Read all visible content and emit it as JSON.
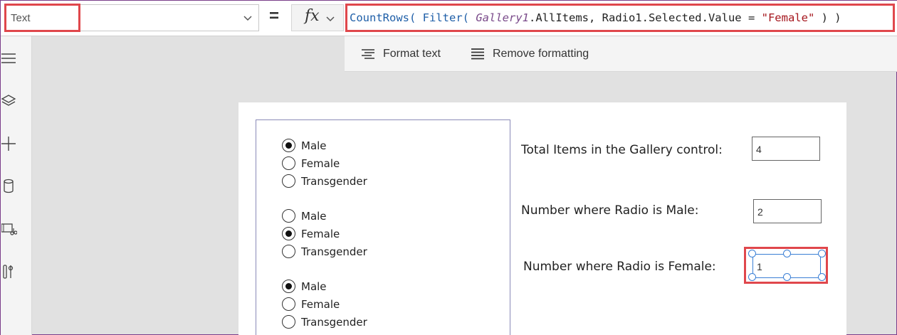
{
  "formula_bar": {
    "property": "Text",
    "equals": "=",
    "fx_label": "fx",
    "formula": {
      "part1": "CountRows(",
      "part2": " ",
      "part3": "Filter(",
      "part4": " ",
      "part5": "Gallery1",
      "part6": ".AllItems, Radio1.Selected.Value = ",
      "part7": "\"Female\"",
      "part8": " ) )"
    }
  },
  "format_toolbar": {
    "format_text": "Format text",
    "remove_formatting": "Remove formatting"
  },
  "left_rail": {
    "icons": [
      "hamburger-menu-icon",
      "layers-icon",
      "plus-icon",
      "database-icon",
      "media-icon",
      "tools-icon"
    ]
  },
  "gallery": {
    "items": [
      {
        "options": [
          "Male",
          "Female",
          "Transgender"
        ],
        "selected": 0
      },
      {
        "options": [
          "Male",
          "Female",
          "Transgender"
        ],
        "selected": 1
      },
      {
        "options": [
          "Male",
          "Female",
          "Transgender"
        ],
        "selected": 0
      }
    ]
  },
  "labels": {
    "total_items": "Total Items in the Gallery control:",
    "male_count": "Number where Radio is Male:",
    "female_count": "Number where Radio is Female:"
  },
  "values": {
    "total_items": "4",
    "male_count": "2",
    "female_count": "1"
  },
  "colors": {
    "highlight": "#e0474c",
    "selection": "#3a7fd5",
    "function_blue": "#1f5fa8",
    "string_red": "#a5161d",
    "gallery_purple": "#7a4a8a"
  }
}
